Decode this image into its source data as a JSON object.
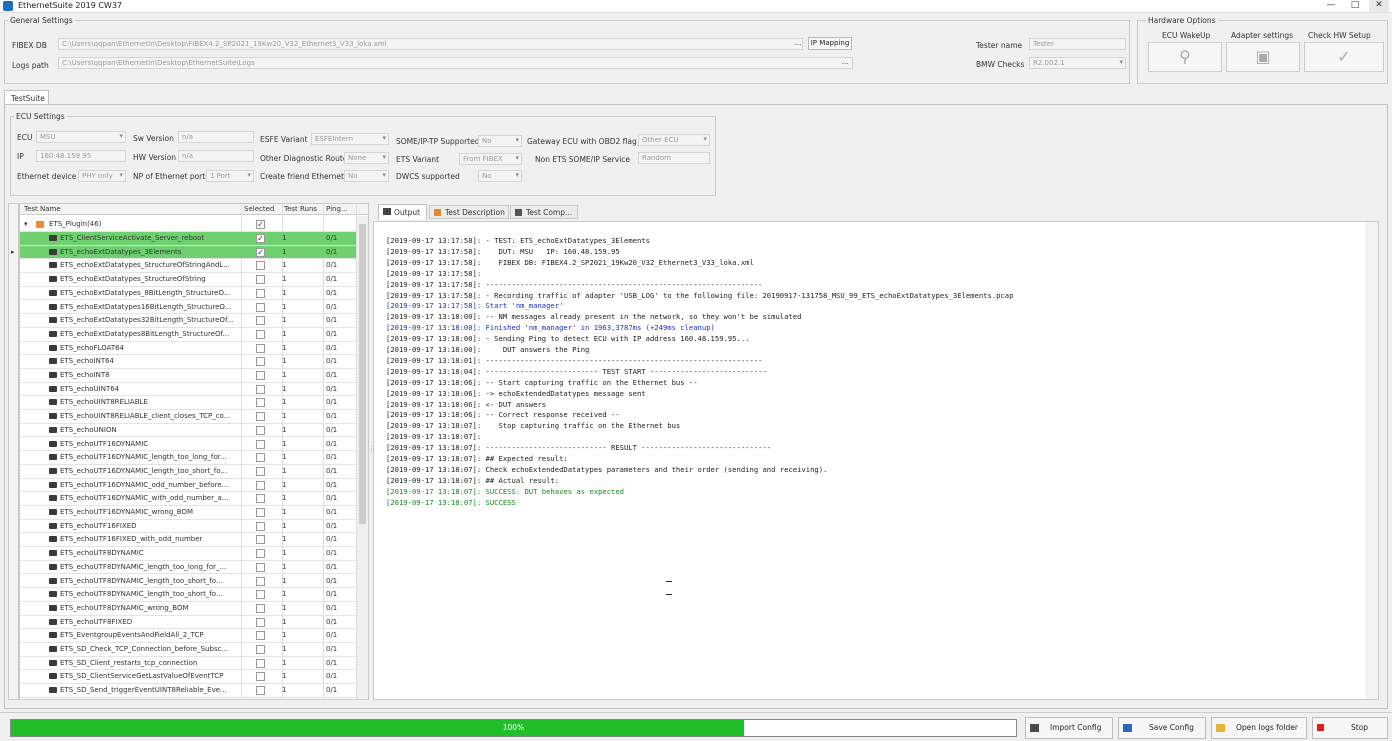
{
  "window": {
    "title": "EthernetSuite 2019 CW37",
    "min": "—",
    "max": "□",
    "close": "✕"
  },
  "general": {
    "title": "General Settings",
    "fibex_label": "FIBEX DB",
    "fibex_value": "C:\\Users\\qqpan\\EthernetIn\\Desktop\\FIBEX4.2_SP2021_19Kw20_V32_Ethernet3_V33_loka.xml",
    "fibex_browse": "...",
    "ip_mapping": "IP Mapping",
    "logs_label": "Logs path",
    "logs_value": "C:\\Users\\qqpan\\EthernetIn\\Desktop\\EthernetSuite\\Logs",
    "logs_browse": "...",
    "tester_label": "Tester name",
    "tester_value": "Tester",
    "bmw_label": "BMW Checks",
    "bmw_value": "R2.002.1"
  },
  "hardware": {
    "title": "Hardware Options",
    "ecu_wakeup": "ECU WakeUp",
    "adapter": "Adapter settings",
    "check_hw": "Check HW Setup"
  },
  "tabs": {
    "testsuite": "TestSuite"
  },
  "ecu": {
    "title": "ECU Settings",
    "ecu_label": "ECU",
    "ecu_value": "MSU",
    "ip_label": "IP",
    "ip_value": "160.48.159.95",
    "eth_device_label": "Ethernet device",
    "eth_device_value": "PHY only",
    "sw_label": "Sw Version",
    "sw_value": "n/a",
    "hw_label": "HW Version",
    "hw_value": "n/a",
    "nports_label": "NP of Ethernet ports",
    "nports_value": "1 Port",
    "esfe_label": "ESFE Variant",
    "esfe_value": "ESFEIntern",
    "diag_label": "Other Diagnostic Route",
    "diag_value": "None",
    "gw_label": "Create friend Ethernet",
    "gw_value": "No",
    "someip_label": "SOME/IP-TP Supported",
    "someip_value": "No",
    "ets_label": "ETS Variant",
    "ets_value": "From FIBEX",
    "dwcs_label": "DWCS supported",
    "dwcs_value": "No",
    "gw_ecu_label": "Gateway ECU with OBD2 flag",
    "gw_ecu_value": "Other ECU",
    "non_ets_label": "Non ETS SOME/IP Service",
    "non_ets_value": "Random"
  },
  "grid": {
    "col_name": "Test Name",
    "col_selected": "Selected",
    "col_duration": "Test Runs",
    "col_result": "Ping...",
    "group": "ETS_Plugin(46)",
    "rows": [
      {
        "name": "ETS_ClientServiceActivate_Server_reboot",
        "sel": "✓",
        "dur": "1",
        "res": "0/1",
        "pass": true
      },
      {
        "name": "ETS_echoExtDatatypes_3Elements",
        "sel": "✓",
        "dur": "1",
        "res": "0/1",
        "pass": true
      },
      {
        "name": "ETS_echoExtDatatypes_StructureOfStringAndL...",
        "sel": "",
        "dur": "1",
        "res": "0/1"
      },
      {
        "name": "ETS_echoExtDatatypes_StructureOfString",
        "sel": "",
        "dur": "1",
        "res": "0/1"
      },
      {
        "name": "ETS_echoExtDatatypes_8BitLength_StructureO...",
        "sel": "",
        "dur": "1",
        "res": "0/1"
      },
      {
        "name": "ETS_echoExtDatatypes16BitLength_StructureO...",
        "sel": "",
        "dur": "1",
        "res": "0/1"
      },
      {
        "name": "ETS_echoExtDatatypes32BitLength_StructureOf...",
        "sel": "",
        "dur": "1",
        "res": "0/1"
      },
      {
        "name": "ETS_echoExtDatatypes8BitLength_StructureOf...",
        "sel": "",
        "dur": "1",
        "res": "0/1"
      },
      {
        "name": "ETS_echoFLOAT64",
        "sel": "",
        "dur": "1",
        "res": "0/1"
      },
      {
        "name": "ETS_echoINT64",
        "sel": "",
        "dur": "1",
        "res": "0/1"
      },
      {
        "name": "ETS_echoINT8",
        "sel": "",
        "dur": "1",
        "res": "0/1"
      },
      {
        "name": "ETS_echoUINT64",
        "sel": "",
        "dur": "1",
        "res": "0/1"
      },
      {
        "name": "ETS_echoUINT8RELIABLE",
        "sel": "",
        "dur": "1",
        "res": "0/1"
      },
      {
        "name": "ETS_echoUINT8RELIABLE_client_closes_TCP_co...",
        "sel": "",
        "dur": "1",
        "res": "0/1"
      },
      {
        "name": "ETS_echoUNION",
        "sel": "",
        "dur": "1",
        "res": "0/1"
      },
      {
        "name": "ETS_echoUTF16DYNAMIC",
        "sel": "",
        "dur": "1",
        "res": "0/1"
      },
      {
        "name": "ETS_echoUTF16DYNAMIC_length_too_long_for...",
        "sel": "",
        "dur": "1",
        "res": "0/1"
      },
      {
        "name": "ETS_echoUTF16DYNAMIC_length_too_short_fo...",
        "sel": "",
        "dur": "1",
        "res": "0/1"
      },
      {
        "name": "ETS_echoUTF16DYNAMIC_odd_number_before...",
        "sel": "",
        "dur": "1",
        "res": "0/1"
      },
      {
        "name": "ETS_echoUTF16DYNAMIC_with_odd_number_a...",
        "sel": "",
        "dur": "1",
        "res": "0/1"
      },
      {
        "name": "ETS_echoUTF16DYNAMIC_wrong_BOM",
        "sel": "",
        "dur": "1",
        "res": "0/1"
      },
      {
        "name": "ETS_echoUTF16FIXED",
        "sel": "",
        "dur": "1",
        "res": "0/1"
      },
      {
        "name": "ETS_echoUTF16FIXED_with_odd_number",
        "sel": "",
        "dur": "1",
        "res": "0/1"
      },
      {
        "name": "ETS_echoUTF8DYNAMIC",
        "sel": "",
        "dur": "1",
        "res": "0/1"
      },
      {
        "name": "ETS_echoUTF8DYNAMIC_length_too_long_for_...",
        "sel": "",
        "dur": "1",
        "res": "0/1"
      },
      {
        "name": "ETS_echoUTF8DYNAMIC_length_too_short_fo...",
        "sel": "",
        "dur": "1",
        "res": "0/1"
      },
      {
        "name": "ETS_echoUTF8DYNAMIC_length_too_short_fo...",
        "sel": "",
        "dur": "1",
        "res": "0/1"
      },
      {
        "name": "ETS_echoUTF8DYNAMIC_wrong_BOM",
        "sel": "",
        "dur": "1",
        "res": "0/1"
      },
      {
        "name": "ETS_echoUTF8FIXED",
        "sel": "",
        "dur": "1",
        "res": "0/1"
      },
      {
        "name": "ETS_EventgroupEventsAndFieldAll_2_TCP",
        "sel": "",
        "dur": "1",
        "res": "0/1"
      },
      {
        "name": "ETS_SD_Check_TCP_Connection_before_Subsc...",
        "sel": "",
        "dur": "1",
        "res": "0/1"
      },
      {
        "name": "ETS_SD_Client_restarts_tcp_connection",
        "sel": "",
        "dur": "1",
        "res": "0/1"
      },
      {
        "name": "ETS_SD_ClientServiceGetLastValueOfEventTCP",
        "sel": "",
        "dur": "1",
        "res": "0/1"
      },
      {
        "name": "ETS_SD_Send_triggerEventUINT8Reliable_Eve...",
        "sel": "",
        "dur": "1",
        "res": "0/1"
      }
    ]
  },
  "out_tabs": {
    "output": "Output",
    "desc": "Test Description",
    "comp": "Test Comp..."
  },
  "log": [
    {
      "t": "[2019-09-17 13:17:58]: - TEST: ETS_echoExtDatatypes_3Elements",
      "c": ""
    },
    {
      "t": "[2019-09-17 13:17:58]:    DUT: MSU   IP: 160.48.159.95",
      "c": ""
    },
    {
      "t": "[2019-09-17 13:17:58]:    FIBEX DB: FIBEX4.2_SP2021_19Kw20_V32_Ethernet3_V33_loka.xml",
      "c": ""
    },
    {
      "t": "[2019-09-17 13:17:58]:",
      "c": ""
    },
    {
      "t": "[2019-09-17 13:17:58]: ----------------------------------------------------------------",
      "c": ""
    },
    {
      "t": "[2019-09-17 13:17:58]: - Recording traffic of adapter 'USB_LOG' to the following file: 20190917-131758_MSU_99_ETS_echoExtDatatypes_3Elements.pcap",
      "c": ""
    },
    {
      "t": "[2019-09-17 13:17:58]: Start 'nm_manager'",
      "c": "blue"
    },
    {
      "t": "[2019-09-17 13:18:00]: -- NM messages already present in the network, so they won't be simulated",
      "c": ""
    },
    {
      "t": "[2019-09-17 13:18:00]: Finished 'nm_manager' in 1963,3787ms (+249ms cleanup)",
      "c": "blue"
    },
    {
      "t": "[2019-09-17 13:18:00]: - Sending Ping to detect ECU with IP address 160.48.159.95...",
      "c": ""
    },
    {
      "t": "[2019-09-17 13:18:00]:     DUT answers the Ping",
      "c": ""
    },
    {
      "t": "[2019-09-17 13:18:01]: ----------------------------------------------------------------",
      "c": ""
    },
    {
      "t": "[2019-09-17 13:18:04]: -------------------------- TEST START ---------------------------",
      "c": ""
    },
    {
      "t": "[2019-09-17 13:18:06]: -- Start capturing traffic on the Ethernet bus --",
      "c": ""
    },
    {
      "t": "[2019-09-17 13:18:06]: -> echoExtendedDatatypes message sent",
      "c": ""
    },
    {
      "t": "[2019-09-17 13:18:06]: <- DUT answers",
      "c": ""
    },
    {
      "t": "[2019-09-17 13:18:06]: -- Correct response received --",
      "c": ""
    },
    {
      "t": "[2019-09-17 13:18:07]:    Stop capturing traffic on the Ethernet bus",
      "c": ""
    },
    {
      "t": "[2019-09-17 13:18:07]:",
      "c": ""
    },
    {
      "t": "[2019-09-17 13:18:07]: ---------------------------- RESULT ------------------------------",
      "c": ""
    },
    {
      "t": "[2019-09-17 13:18:07]: ## Expected result:",
      "c": ""
    },
    {
      "t": "[2019-09-17 13:18:07]: Check echoExtendedDatatypes parameters and their order (sending and receiving).",
      "c": ""
    },
    {
      "t": "[2019-09-17 13:18:07]: ## Actual result:",
      "c": ""
    },
    {
      "t": "[2019-09-17 13:18:07]: SUCCESS: DUT behaves as expected",
      "c": "green"
    },
    {
      "t": "[2019-09-17 13:18:07]: SUCCESS",
      "c": "green"
    }
  ],
  "bottom": {
    "progress": 0.7298,
    "progress_text": "100%",
    "import": "Import Config",
    "save": "Save Config",
    "open_logs": "Open logs folder",
    "stop": "Stop"
  }
}
